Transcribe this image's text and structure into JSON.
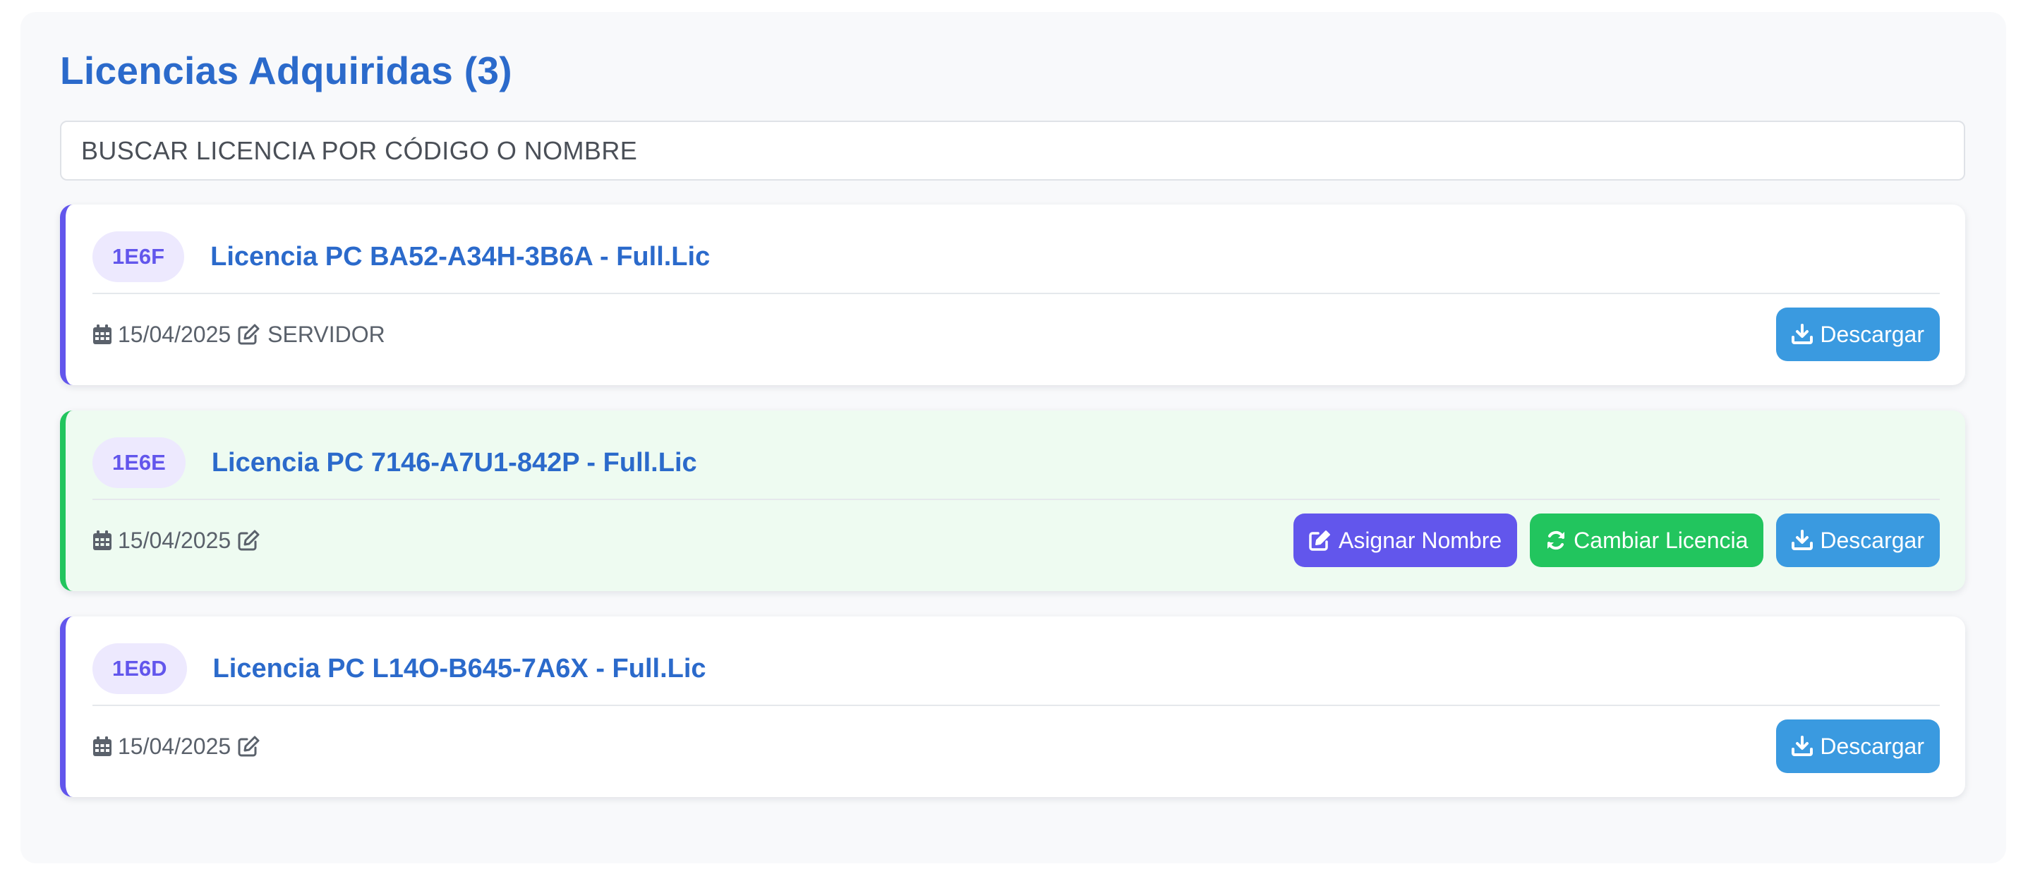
{
  "header": {
    "title": "Licencias Adquiridas (3)"
  },
  "search": {
    "placeholder": "BUSCAR LICENCIA POR CÓDIGO O NOMBRE"
  },
  "actions": {
    "download_label": "Descargar",
    "assign_label": "Asignar Nombre",
    "change_label": "Cambiar Licencia"
  },
  "licenses": [
    {
      "code": "1E6F",
      "title": "Licencia PC BA52-A34H-3B6A - Full.Lic",
      "date": "15/04/2025",
      "name": "SERVIDOR",
      "highlighted": false
    },
    {
      "code": "1E6E",
      "title": "Licencia PC 7146-A7U1-842P - Full.Lic",
      "date": "15/04/2025",
      "name": "",
      "highlighted": true
    },
    {
      "code": "1E6D",
      "title": "Licencia PC L14O-B645-7A6X - Full.Lic",
      "date": "15/04/2025",
      "name": "",
      "highlighted": false
    }
  ],
  "colors": {
    "title": "#2b6acb",
    "accent_purple": "#6256ec",
    "accent_green": "#22c55e",
    "download_blue": "#3a9ae0",
    "highlight_bg": "#eefbf1"
  },
  "icons": {
    "date": "calendar-icon",
    "edit": "edit-icon",
    "download": "download-icon",
    "assign": "edit-icon",
    "change": "refresh-icon"
  }
}
